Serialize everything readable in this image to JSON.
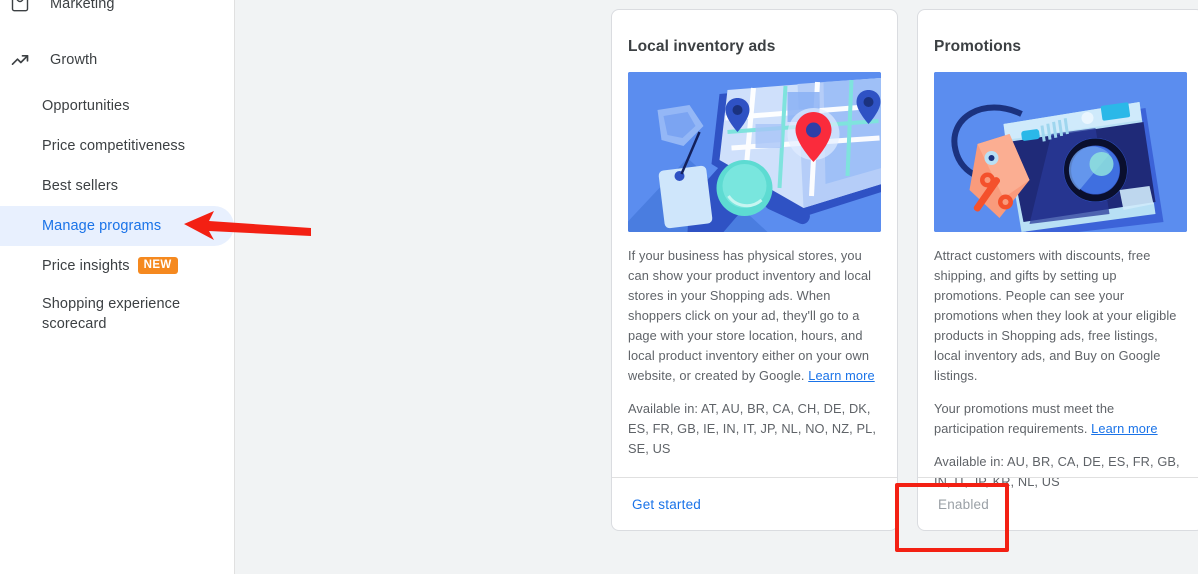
{
  "sidebar": {
    "sections": [
      {
        "label": "Marketing",
        "icon": "campaign-icon"
      },
      {
        "label": "Growth",
        "icon": "trending-up-icon"
      }
    ],
    "items": [
      {
        "label": "Opportunities",
        "selected": false,
        "badge": null
      },
      {
        "label": "Price competitiveness",
        "selected": false,
        "badge": null
      },
      {
        "label": "Best sellers",
        "selected": false,
        "badge": null
      },
      {
        "label": "Manage programs",
        "selected": true,
        "badge": null
      },
      {
        "label": "Price insights",
        "selected": false,
        "badge": "NEW"
      },
      {
        "label": "Shopping experience scorecard",
        "selected": false,
        "badge": null
      }
    ]
  },
  "cards": [
    {
      "title": "Local inventory ads",
      "hero_icon": "map-with-pins-and-price-tag-illustration",
      "description_before_link": "If your business has physical stores, you can show your product inventory and local stores in your Shopping ads. When shoppers click on your ad, they'll go to a page with your store location, hours, and local product inventory either on your own website, or created by Google. ",
      "link_label": "Learn more",
      "second_paragraph": null,
      "second_link_label": null,
      "availability": "Available in: AT, AU, BR, CA, CH, DE, DK, ES, FR, GB, IE, IN, IT, JP, NL, NO, NZ, PL, SE, US",
      "footer_label": "Get started",
      "footer_type": "action"
    },
    {
      "title": "Promotions",
      "hero_icon": "camera-with-discount-tag-illustration",
      "description_before_link": "Attract customers with discounts, free shipping, and gifts by setting up promotions. People can see your promotions when they look at your eligible products in Shopping ads, free listings, local inventory ads, and Buy on Google listings.",
      "link_label": null,
      "second_paragraph": "Your promotions must meet the participation requirements. ",
      "second_link_label": "Learn more",
      "availability": "Available in: AU, BR, CA, DE, ES, FR, GB, IN, IT, JP, KR, NL, US",
      "footer_label": "Enabled",
      "footer_type": "status"
    }
  ],
  "annotations": {
    "arrow": {
      "color": "#f32013",
      "points_to": "Manage programs"
    },
    "highlight_box": {
      "color": "#f32013",
      "around": "Enabled"
    }
  },
  "colors": {
    "accent_blue": "#1a73e8",
    "selected_bg": "#e8f0fe",
    "badge_orange": "#f5891f",
    "annotation_red": "#f32013",
    "page_bg": "#f1f3f4",
    "text_primary": "#3c4043",
    "text_secondary": "#5f6368",
    "text_disabled": "#9aa0a6"
  }
}
